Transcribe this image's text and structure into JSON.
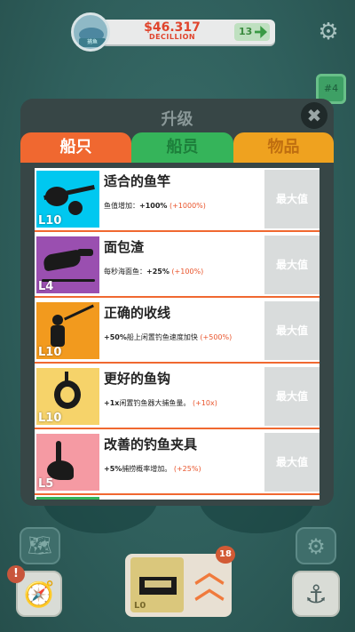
{
  "header": {
    "avatar_tag": "捕鱼",
    "money_value": "$46.317",
    "money_unit": "DECILLION",
    "gems": "13"
  },
  "side_chip": "#4",
  "modal": {
    "title": "升级",
    "close_label": "✖",
    "tabs": [
      {
        "label": "船只",
        "active": true
      },
      {
        "label": "船员",
        "active": false
      },
      {
        "label": "物品",
        "active": false
      }
    ],
    "rows": [
      {
        "name": "适合的鱼竿",
        "level": "L10",
        "desc_prefix": "鱼值增加：",
        "desc_value": "+100%",
        "desc_bonus": "(+1000%)",
        "button": "最大值",
        "color": "#00c8f0"
      },
      {
        "name": "面包渣",
        "level": "L4",
        "desc_prefix": "每秒海面鱼：",
        "desc_value": "+25%",
        "desc_bonus": "(+100%)",
        "button": "最大值",
        "color": "#9a4fb0"
      },
      {
        "name": "正确的收线",
        "level": "L10",
        "desc_prefix": "",
        "desc_value": "+50%",
        "desc_bonus": "(+500%)",
        "desc_mid": "船上闲置钓鱼速度加快",
        "button": "最大值",
        "color": "#f29a1e"
      },
      {
        "name": "更好的鱼钩",
        "level": "L10",
        "desc_prefix": "",
        "desc_value": "+1x",
        "desc_bonus": "(+10x)",
        "desc_mid": "闲置钓鱼器大捕鱼量。",
        "button": "最大值",
        "color": "#f6d36a"
      },
      {
        "name": "改善的钓鱼夹具",
        "level": "L5",
        "desc_prefix": "",
        "desc_value": "+5%",
        "desc_bonus": "(+25%)",
        "desc_mid": "捕捞概率增加。",
        "button": "最大值",
        "color": "#f59aa3"
      }
    ]
  },
  "bottom": {
    "alert": "!",
    "boat_level": "L0",
    "upgrade_count": "18"
  }
}
